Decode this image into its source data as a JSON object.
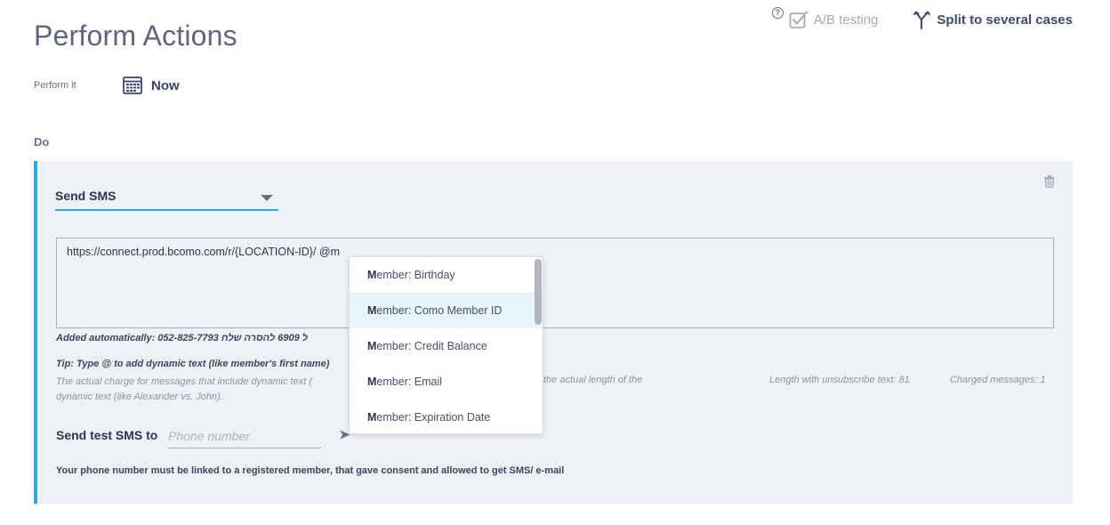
{
  "header": {
    "title": "Perform Actions",
    "help_glyph": "?",
    "ab_testing_label": "A/B testing",
    "split_label": "Split to several cases"
  },
  "perform": {
    "label": "Perform it",
    "value": "Now"
  },
  "do_label": "Do",
  "action": {
    "selected": "Send SMS",
    "message_text": "https://connect.prod.bcomo.com/r/{LOCATION-ID}/ @m",
    "added_automatically": "Added automatically: 052-825-7793 ל 6909 להסרה שלח",
    "tip": "Tip: Type @ to add dynamic text (like member's first name)",
    "charge_note": "The actual charge for messages that include dynamic text (",
    "charge_note_end": "the actual length of the",
    "charge_note_2": "dynamic text (like Alexander vs. John).",
    "length_text": "Length with unsubscribe text: 81",
    "charged_text": "Charged messages: 1",
    "test_label": "Send test SMS to",
    "phone_placeholder": "Phone number",
    "phone_value": "",
    "note": "Your phone number must be linked to a registered member, that gave consent and allowed to get SMS/ e-mail"
  },
  "autocomplete": {
    "match": "M",
    "items": [
      {
        "rest": "ember: Birthday"
      },
      {
        "rest": "ember: Como Member ID"
      },
      {
        "rest": "ember: Credit Balance"
      },
      {
        "rest": "ember: Email"
      },
      {
        "rest": "ember: Expiration Date"
      }
    ],
    "highlighted_index": 1
  },
  "colors": {
    "accent": "#29abe2",
    "panel_bg": "#eef1f5",
    "title": "#5f6482",
    "dark_text": "#2e3450",
    "muted": "#a6a9bd"
  },
  "icons": [
    "help-icon",
    "checkbox-icon",
    "split-icon",
    "calendar-icon",
    "chevron-down-icon",
    "trash-icon",
    "send-icon"
  ]
}
